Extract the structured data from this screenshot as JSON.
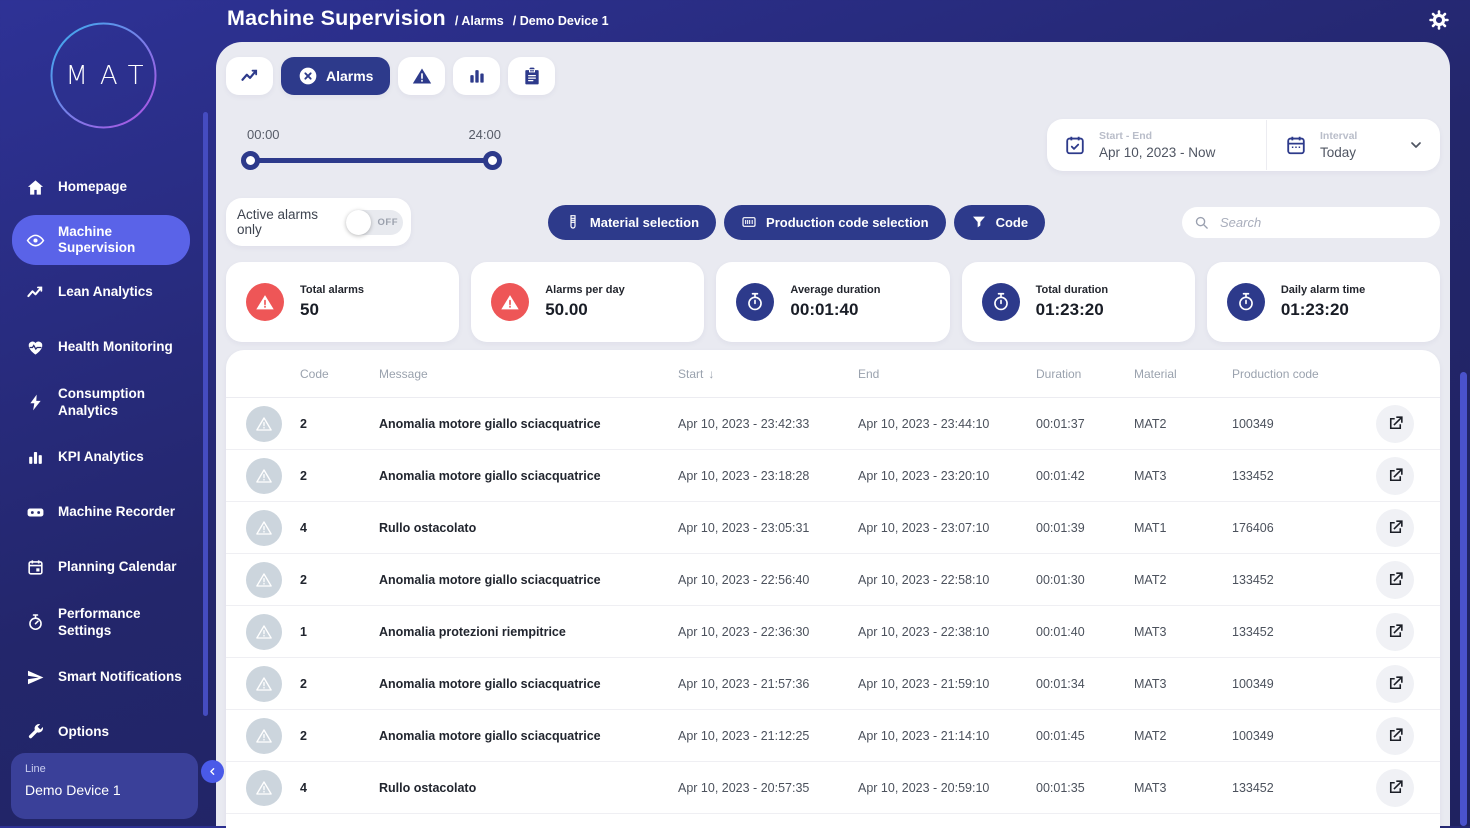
{
  "colors": {
    "accent": "#2d3a8b",
    "red": "#ee5657",
    "nav_active": "#5a63e8",
    "panel_bg": "#e9eaf1"
  },
  "header": {
    "title": "Machine Supervision",
    "breadcrumbs": [
      "Alarms",
      "Demo Device 1"
    ],
    "gear_icon": "gear"
  },
  "sidebar": {
    "logo_text": "MAT",
    "items": [
      {
        "id": "homepage",
        "label": "Homepage",
        "icon": "home",
        "active": false
      },
      {
        "id": "machine-supervision",
        "label": "Machine Supervision",
        "icon": "eye",
        "active": true
      },
      {
        "id": "lean-analytics",
        "label": "Lean Analytics",
        "icon": "trend",
        "active": false
      },
      {
        "id": "health-monitoring",
        "label": "Health Monitoring",
        "icon": "heart",
        "active": false
      },
      {
        "id": "consumption-analytics",
        "label": "Consumption Analytics",
        "icon": "bolt",
        "active": false
      },
      {
        "id": "kpi-analytics",
        "label": "KPI Analytics",
        "icon": "bars",
        "active": false
      },
      {
        "id": "machine-recorder",
        "label": "Machine Recorder",
        "icon": "recorder",
        "active": false
      },
      {
        "id": "planning-calendar",
        "label": "Planning Calendar",
        "icon": "calendar",
        "active": false
      },
      {
        "id": "performance-settings",
        "label": "Performance Settings",
        "icon": "gauge",
        "active": false
      },
      {
        "id": "smart-notifications",
        "label": "Smart Notifications",
        "icon": "send",
        "active": false
      },
      {
        "id": "options",
        "label": "Options",
        "icon": "wrench",
        "active": false
      }
    ],
    "device": {
      "label": "Line",
      "name": "Demo Device 1"
    },
    "collapse_icon": "chevron-left"
  },
  "tabs": [
    {
      "id": "trends",
      "icon": "trend",
      "label": "",
      "active": false
    },
    {
      "id": "alarms",
      "icon": "circle-x",
      "label": "Alarms",
      "active": true
    },
    {
      "id": "warnings",
      "icon": "triangle",
      "label": "",
      "active": false
    },
    {
      "id": "statistics",
      "icon": "bars",
      "label": "",
      "active": false
    },
    {
      "id": "report",
      "icon": "clipboard",
      "label": "",
      "active": false
    }
  ],
  "time_slider": {
    "start_label": "00:00",
    "end_label": "24:00"
  },
  "date_filter": {
    "range_icon": "calendar-check",
    "range_label": "Start - End",
    "range_value": "Apr 10, 2023 - Now",
    "interval_icon": "calendar-plain",
    "interval_label": "Interval",
    "interval_value": "Today",
    "chevron_icon": "chevron-down"
  },
  "filter_bar": {
    "active_alarms_label": "Active alarms only",
    "toggle_state": "OFF",
    "material_button": "Material selection",
    "material_icon": "vial",
    "production_button": "Production code selection",
    "production_icon": "barcode",
    "code_button": "Code",
    "code_icon": "funnel",
    "search_icon": "search",
    "search_placeholder": "Search"
  },
  "stats": [
    {
      "label": "Total alarms",
      "value": "50",
      "icon": "alarm-triangle",
      "color": "red"
    },
    {
      "label": "Alarms per day",
      "value": "50.00",
      "icon": "alarm-triangle",
      "color": "red"
    },
    {
      "label": "Average duration",
      "value": "00:01:40",
      "icon": "timer",
      "color": "blue"
    },
    {
      "label": "Total duration",
      "value": "01:23:20",
      "icon": "timer",
      "color": "blue"
    },
    {
      "label": "Daily alarm time",
      "value": "01:23:20",
      "icon": "timer",
      "color": "blue"
    }
  ],
  "table": {
    "columns": [
      "Code",
      "Message",
      "Start",
      "End",
      "Duration",
      "Material",
      "Production code"
    ],
    "sorted_by": "Start",
    "sort_arrow": "↓",
    "row_icon": "warning-outline",
    "action_icon": "launch",
    "rows": [
      {
        "code": "2",
        "message": "Anomalia motore giallo sciacquatrice",
        "start": "Apr 10, 2023 - 23:42:33",
        "end": "Apr 10, 2023 - 23:44:10",
        "duration": "00:01:37",
        "material": "MAT2",
        "production_code": "100349"
      },
      {
        "code": "2",
        "message": "Anomalia motore giallo sciacquatrice",
        "start": "Apr 10, 2023 - 23:18:28",
        "end": "Apr 10, 2023 - 23:20:10",
        "duration": "00:01:42",
        "material": "MAT3",
        "production_code": "133452"
      },
      {
        "code": "4",
        "message": "Rullo ostacolato",
        "start": "Apr 10, 2023 - 23:05:31",
        "end": "Apr 10, 2023 - 23:07:10",
        "duration": "00:01:39",
        "material": "MAT1",
        "production_code": "176406"
      },
      {
        "code": "2",
        "message": "Anomalia motore giallo sciacquatrice",
        "start": "Apr 10, 2023 - 22:56:40",
        "end": "Apr 10, 2023 - 22:58:10",
        "duration": "00:01:30",
        "material": "MAT2",
        "production_code": "133452"
      },
      {
        "code": "1",
        "message": "Anomalia protezioni riempitrice",
        "start": "Apr 10, 2023 - 22:36:30",
        "end": "Apr 10, 2023 - 22:38:10",
        "duration": "00:01:40",
        "material": "MAT3",
        "production_code": "133452"
      },
      {
        "code": "2",
        "message": "Anomalia motore giallo sciacquatrice",
        "start": "Apr 10, 2023 - 21:57:36",
        "end": "Apr 10, 2023 - 21:59:10",
        "duration": "00:01:34",
        "material": "MAT3",
        "production_code": "100349"
      },
      {
        "code": "2",
        "message": "Anomalia motore giallo sciacquatrice",
        "start": "Apr 10, 2023 - 21:12:25",
        "end": "Apr 10, 2023 - 21:14:10",
        "duration": "00:01:45",
        "material": "MAT2",
        "production_code": "100349"
      },
      {
        "code": "4",
        "message": "Rullo ostacolato",
        "start": "Apr 10, 2023 - 20:57:35",
        "end": "Apr 10, 2023 - 20:59:10",
        "duration": "00:01:35",
        "material": "MAT3",
        "production_code": "133452"
      }
    ]
  }
}
